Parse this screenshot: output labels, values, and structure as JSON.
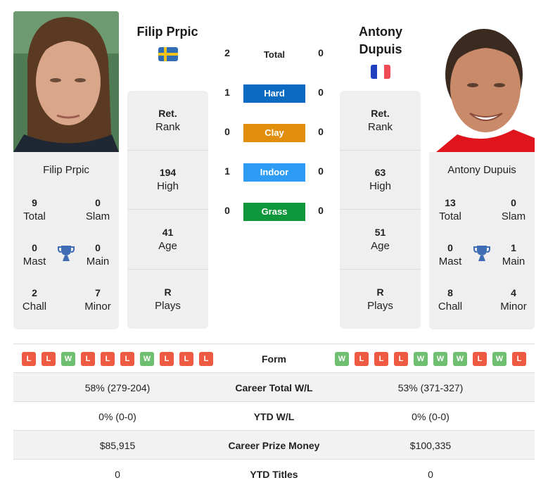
{
  "colors": {
    "hard": "#0b6bc2",
    "clay": "#e08e0b",
    "indoor": "#2e9cf5",
    "grass": "#0f973b",
    "win": "#6ebf6f",
    "loss": "#ee5b42",
    "trophy": "#3e6db5",
    "flag_se_blue": "#2f6eb5",
    "flag_se_yellow": "#f3c31d",
    "flag_fr_blue": "#1f3fbf",
    "flag_fr_white": "#ffffff",
    "flag_fr_red": "#ef4b57"
  },
  "player1": {
    "name": "Filip Prpic",
    "country_flag": "sweden-flag",
    "stats": [
      {
        "value": "Ret.",
        "label": "Rank"
      },
      {
        "value": "194",
        "label": "High"
      },
      {
        "value": "41",
        "label": "Age"
      },
      {
        "value": "R",
        "label": "Plays"
      }
    ],
    "titles": {
      "total": {
        "value": "9",
        "label": "Total"
      },
      "slam": {
        "value": "0",
        "label": "Slam"
      },
      "mast": {
        "value": "0",
        "label": "Mast"
      },
      "main": {
        "value": "0",
        "label": "Main"
      },
      "chall": {
        "value": "2",
        "label": "Chall"
      },
      "minor": {
        "value": "7",
        "label": "Minor"
      }
    },
    "form": [
      "L",
      "L",
      "W",
      "L",
      "L",
      "L",
      "W",
      "L",
      "L",
      "L"
    ]
  },
  "player2": {
    "name": "Antony Dupuis",
    "name_line1": "Antony",
    "name_line2": "Dupuis",
    "country_flag": "france-flag",
    "stats": [
      {
        "value": "Ret.",
        "label": "Rank"
      },
      {
        "value": "63",
        "label": "High"
      },
      {
        "value": "51",
        "label": "Age"
      },
      {
        "value": "R",
        "label": "Plays"
      }
    ],
    "titles": {
      "total": {
        "value": "13",
        "label": "Total"
      },
      "slam": {
        "value": "0",
        "label": "Slam"
      },
      "mast": {
        "value": "0",
        "label": "Mast"
      },
      "main": {
        "value": "1",
        "label": "Main"
      },
      "chall": {
        "value": "8",
        "label": "Chall"
      },
      "minor": {
        "value": "4",
        "label": "Minor"
      }
    },
    "form": [
      "W",
      "L",
      "L",
      "L",
      "W",
      "W",
      "W",
      "L",
      "W",
      "L"
    ]
  },
  "h2h": [
    {
      "label": "Total",
      "p1": "2",
      "p2": "0"
    },
    {
      "label": "Hard",
      "p1": "1",
      "p2": "0"
    },
    {
      "label": "Clay",
      "p1": "0",
      "p2": "0"
    },
    {
      "label": "Indoor",
      "p1": "1",
      "p2": "0"
    },
    {
      "label": "Grass",
      "p1": "0",
      "p2": "0"
    }
  ],
  "comparison": [
    {
      "label": "Form"
    },
    {
      "label": "Career Total W/L",
      "p1": "58% (279-204)",
      "p2": "53% (371-327)"
    },
    {
      "label": "YTD W/L",
      "p1": "0% (0-0)",
      "p2": "0% (0-0)"
    },
    {
      "label": "Career Prize Money",
      "p1": "$85,915",
      "p2": "$100,335"
    },
    {
      "label": "YTD Titles",
      "p1": "0",
      "p2": "0"
    }
  ]
}
